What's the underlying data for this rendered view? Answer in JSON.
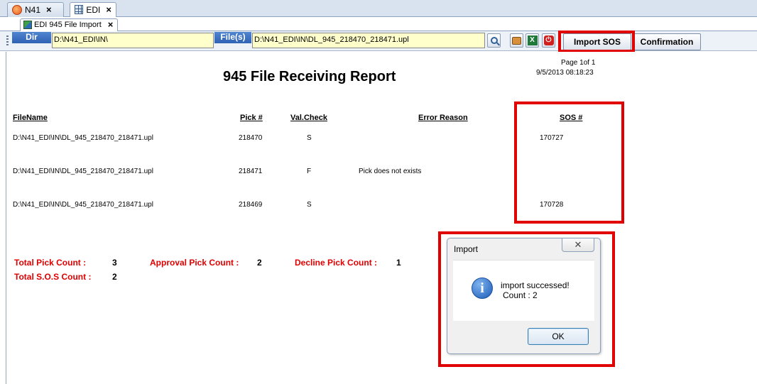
{
  "doc_tabs": [
    {
      "label": "N41",
      "close": "×"
    },
    {
      "label": "EDI",
      "close": "×"
    }
  ],
  "sub_tab": {
    "label": "EDI 945 File Import",
    "close": "×"
  },
  "toolbar": {
    "dir_label": "Dir",
    "dir_value": "D:\\N41_EDI\\IN\\",
    "files_label": "File(s)",
    "files_value": "D:\\N41_EDI\\IN\\DL_945_218470_218471.upl",
    "import_sos_label": "Import SOS",
    "confirmation_label": "Confirmation",
    "excel_glyph": "X",
    "power_glyph": "⏻"
  },
  "report": {
    "title": "945 File Receiving Report",
    "page": "Page 1of 1",
    "timestamp": "9/5/2013 08:18:23",
    "columns": {
      "filename": "FileName",
      "pick": "Pick #",
      "valcheck": "Val.Check",
      "error": "Error Reason",
      "sos": "SOS #"
    },
    "rows": [
      {
        "filename": "D:\\N41_EDI\\IN\\DL_945_218470_218471.upl",
        "pick": "218470",
        "valcheck": "S",
        "error": "",
        "sos": "170727"
      },
      {
        "filename": "D:\\N41_EDI\\IN\\DL_945_218470_218471.upl",
        "pick": "218471",
        "valcheck": "F",
        "error": "Pick does not exists",
        "sos": ""
      },
      {
        "filename": "D:\\N41_EDI\\IN\\DL_945_218470_218471.upl",
        "pick": "218469",
        "valcheck": "S",
        "error": "",
        "sos": "170728"
      }
    ],
    "totals": {
      "total_pick_label": "Total Pick Count :",
      "total_pick_value": "3",
      "approval_label": "Approval Pick Count :",
      "approval_value": "2",
      "decline_label": "Decline Pick Count :",
      "decline_value": "1",
      "total_sos_label": "Total S.O.S Count :",
      "total_sos_value": "2"
    }
  },
  "dialog": {
    "title": "Import",
    "close": "✕",
    "message_line1": "import successed!",
    "message_line2": "Count : 2",
    "ok_label": "OK"
  },
  "colors": {
    "highlight": "#e00000",
    "field_bg": "#ffffcc",
    "label_blue": "#2f63b3"
  }
}
